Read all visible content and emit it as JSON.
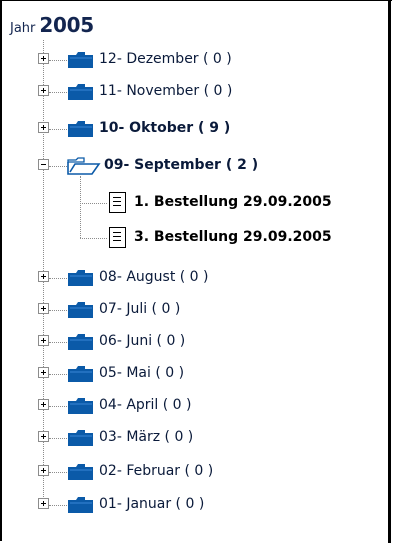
{
  "tree": {
    "year_label": "Jahr",
    "year_value": "2005",
    "months": [
      {
        "label": "12- Dezember ( 0 )",
        "expanded": false,
        "bold": false
      },
      {
        "label": "11- November ( 0 )",
        "expanded": false,
        "bold": false
      },
      {
        "label": "10- Oktober ( 9 )",
        "expanded": false,
        "bold": true
      },
      {
        "label": "09- September ( 2 )",
        "expanded": true,
        "bold": true
      },
      {
        "label": "08- August ( 0 )",
        "expanded": false,
        "bold": false
      },
      {
        "label": "07- Juli ( 0 )",
        "expanded": false,
        "bold": false
      },
      {
        "label": "06- Juni ( 0 )",
        "expanded": false,
        "bold": false
      },
      {
        "label": "05- Mai ( 0 )",
        "expanded": false,
        "bold": false
      },
      {
        "label": "04- April ( 0 )",
        "expanded": false,
        "bold": false
      },
      {
        "label": "03- März ( 0 )",
        "expanded": false,
        "bold": false
      },
      {
        "label": "02- Februar ( 0 )",
        "expanded": false,
        "bold": false
      },
      {
        "label": "01- Januar ( 0 )",
        "expanded": false,
        "bold": false
      }
    ],
    "september_children": [
      {
        "label": "1. Bestellung 29.09.2005"
      },
      {
        "label": "3. Bestellung 29.09.2005"
      }
    ]
  },
  "icons": {
    "folder_closed": "folder-closed-icon",
    "folder_open": "folder-open-icon",
    "document": "document-icon",
    "expand": "plus-icon",
    "collapse": "minus-icon"
  },
  "colors": {
    "folder": "#0b5aa8",
    "text": "#0a1a3a",
    "connector": "#8c8c8c"
  }
}
